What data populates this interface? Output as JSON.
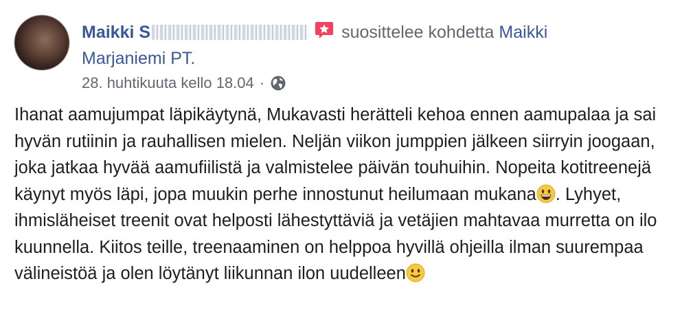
{
  "post": {
    "author_name_visible": "Maikki S",
    "action_text": "suosittelee kohdetta",
    "target_line1": "Maikki",
    "target_line2": "Marjaniemi PT.",
    "timestamp": "28. huhtikuuta kello 18.04",
    "separator": "·",
    "recommend_icon": "recommendation-star-icon",
    "privacy_icon": "globe-icon",
    "body": {
      "part1": "Ihanat aamujumpat läpikäytynä, Mukavasti herätteli kehoa ennen aamupalaa ja sai hyvän rutiinin ja rauhallisen mielen. Neljän viikon jumppien jälkeen siirryin joogaan, joka jatkaa hyvää aamufiilistä ja valmistelee päivän touhuihin. Nopeita kotitreenejä käynyt myös läpi, jopa muukin perhe innostunut heilumaan mukana",
      "emoji1": "grinning-face-emoji",
      "part2": ". Lyhyet, ihmisläheiset treenit ovat helposti lähestyttäviä ja vetäjien mahtavaa murretta on ilo kuunnella. Kiitos teille, treenaaminen on helppoa hyvillä ohjeilla ilman suurempaa välineistöä ja olen löytänyt liikunnan ilon uudelleen",
      "emoji2": "slightly-smiling-face-emoji"
    },
    "colors": {
      "link": "#385898",
      "meta": "#606770",
      "text": "#1c1e21",
      "recommend": "#f3425f"
    }
  }
}
